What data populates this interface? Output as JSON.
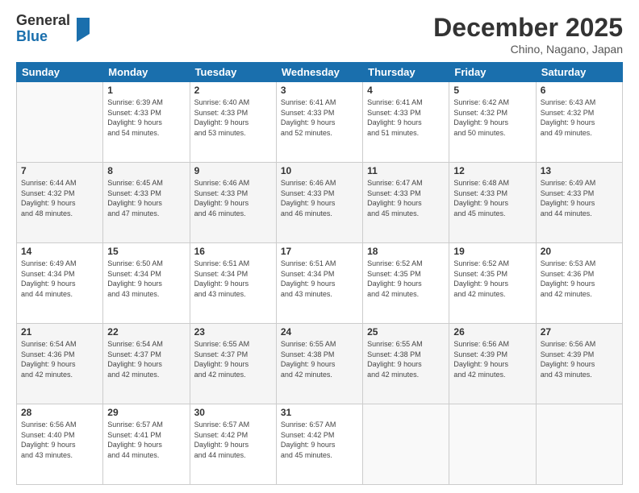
{
  "logo": {
    "general": "General",
    "blue": "Blue"
  },
  "header": {
    "month": "December 2025",
    "location": "Chino, Nagano, Japan"
  },
  "weekdays": [
    "Sunday",
    "Monday",
    "Tuesday",
    "Wednesday",
    "Thursday",
    "Friday",
    "Saturday"
  ],
  "weeks": [
    [
      {
        "day": "",
        "info": ""
      },
      {
        "day": "1",
        "info": "Sunrise: 6:39 AM\nSunset: 4:33 PM\nDaylight: 9 hours\nand 54 minutes."
      },
      {
        "day": "2",
        "info": "Sunrise: 6:40 AM\nSunset: 4:33 PM\nDaylight: 9 hours\nand 53 minutes."
      },
      {
        "day": "3",
        "info": "Sunrise: 6:41 AM\nSunset: 4:33 PM\nDaylight: 9 hours\nand 52 minutes."
      },
      {
        "day": "4",
        "info": "Sunrise: 6:41 AM\nSunset: 4:33 PM\nDaylight: 9 hours\nand 51 minutes."
      },
      {
        "day": "5",
        "info": "Sunrise: 6:42 AM\nSunset: 4:32 PM\nDaylight: 9 hours\nand 50 minutes."
      },
      {
        "day": "6",
        "info": "Sunrise: 6:43 AM\nSunset: 4:32 PM\nDaylight: 9 hours\nand 49 minutes."
      }
    ],
    [
      {
        "day": "7",
        "info": "Sunrise: 6:44 AM\nSunset: 4:32 PM\nDaylight: 9 hours\nand 48 minutes."
      },
      {
        "day": "8",
        "info": "Sunrise: 6:45 AM\nSunset: 4:33 PM\nDaylight: 9 hours\nand 47 minutes."
      },
      {
        "day": "9",
        "info": "Sunrise: 6:46 AM\nSunset: 4:33 PM\nDaylight: 9 hours\nand 46 minutes."
      },
      {
        "day": "10",
        "info": "Sunrise: 6:46 AM\nSunset: 4:33 PM\nDaylight: 9 hours\nand 46 minutes."
      },
      {
        "day": "11",
        "info": "Sunrise: 6:47 AM\nSunset: 4:33 PM\nDaylight: 9 hours\nand 45 minutes."
      },
      {
        "day": "12",
        "info": "Sunrise: 6:48 AM\nSunset: 4:33 PM\nDaylight: 9 hours\nand 45 minutes."
      },
      {
        "day": "13",
        "info": "Sunrise: 6:49 AM\nSunset: 4:33 PM\nDaylight: 9 hours\nand 44 minutes."
      }
    ],
    [
      {
        "day": "14",
        "info": "Sunrise: 6:49 AM\nSunset: 4:34 PM\nDaylight: 9 hours\nand 44 minutes."
      },
      {
        "day": "15",
        "info": "Sunrise: 6:50 AM\nSunset: 4:34 PM\nDaylight: 9 hours\nand 43 minutes."
      },
      {
        "day": "16",
        "info": "Sunrise: 6:51 AM\nSunset: 4:34 PM\nDaylight: 9 hours\nand 43 minutes."
      },
      {
        "day": "17",
        "info": "Sunrise: 6:51 AM\nSunset: 4:34 PM\nDaylight: 9 hours\nand 43 minutes."
      },
      {
        "day": "18",
        "info": "Sunrise: 6:52 AM\nSunset: 4:35 PM\nDaylight: 9 hours\nand 42 minutes."
      },
      {
        "day": "19",
        "info": "Sunrise: 6:52 AM\nSunset: 4:35 PM\nDaylight: 9 hours\nand 42 minutes."
      },
      {
        "day": "20",
        "info": "Sunrise: 6:53 AM\nSunset: 4:36 PM\nDaylight: 9 hours\nand 42 minutes."
      }
    ],
    [
      {
        "day": "21",
        "info": "Sunrise: 6:54 AM\nSunset: 4:36 PM\nDaylight: 9 hours\nand 42 minutes."
      },
      {
        "day": "22",
        "info": "Sunrise: 6:54 AM\nSunset: 4:37 PM\nDaylight: 9 hours\nand 42 minutes."
      },
      {
        "day": "23",
        "info": "Sunrise: 6:55 AM\nSunset: 4:37 PM\nDaylight: 9 hours\nand 42 minutes."
      },
      {
        "day": "24",
        "info": "Sunrise: 6:55 AM\nSunset: 4:38 PM\nDaylight: 9 hours\nand 42 minutes."
      },
      {
        "day": "25",
        "info": "Sunrise: 6:55 AM\nSunset: 4:38 PM\nDaylight: 9 hours\nand 42 minutes."
      },
      {
        "day": "26",
        "info": "Sunrise: 6:56 AM\nSunset: 4:39 PM\nDaylight: 9 hours\nand 42 minutes."
      },
      {
        "day": "27",
        "info": "Sunrise: 6:56 AM\nSunset: 4:39 PM\nDaylight: 9 hours\nand 43 minutes."
      }
    ],
    [
      {
        "day": "28",
        "info": "Sunrise: 6:56 AM\nSunset: 4:40 PM\nDaylight: 9 hours\nand 43 minutes."
      },
      {
        "day": "29",
        "info": "Sunrise: 6:57 AM\nSunset: 4:41 PM\nDaylight: 9 hours\nand 44 minutes."
      },
      {
        "day": "30",
        "info": "Sunrise: 6:57 AM\nSunset: 4:42 PM\nDaylight: 9 hours\nand 44 minutes."
      },
      {
        "day": "31",
        "info": "Sunrise: 6:57 AM\nSunset: 4:42 PM\nDaylight: 9 hours\nand 45 minutes."
      },
      {
        "day": "",
        "info": ""
      },
      {
        "day": "",
        "info": ""
      },
      {
        "day": "",
        "info": ""
      }
    ]
  ]
}
